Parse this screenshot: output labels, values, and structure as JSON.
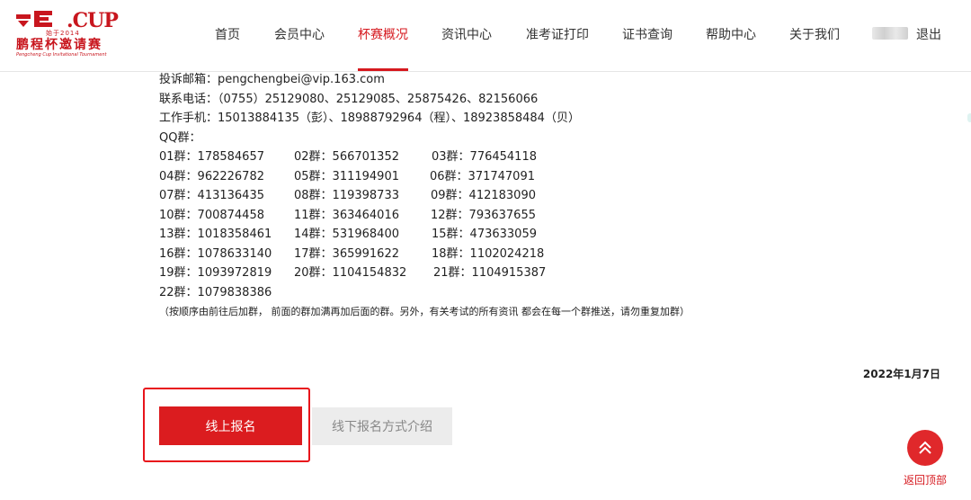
{
  "logo": {
    "cup_text": ".CUP",
    "year_text": "始于2014",
    "cn_text": "鹏程杯邀请赛",
    "en_text": "Pengcheng Cup Invitational Tournament"
  },
  "nav": {
    "items": [
      {
        "label": "首页"
      },
      {
        "label": "会员中心"
      },
      {
        "label": "杯赛概况"
      },
      {
        "label": "资讯中心"
      },
      {
        "label": "准考证打印"
      },
      {
        "label": "证书查询"
      },
      {
        "label": "帮助中心"
      },
      {
        "label": "关于我们"
      }
    ],
    "active_index": 2,
    "logout": "退出"
  },
  "contact": {
    "email_line": "投诉邮箱：pengchengbei@vip.163.com",
    "phone_line": "联系电话：（0755）25129080、25129085、25875426、82156066",
    "mobile_line": "工作手机：15013884135（彭）、18988792964（程）、18923858484（贝）",
    "qq_title": "QQ群："
  },
  "qq_groups": [
    [
      "01群：178584657",
      "02群：566701352",
      "03群：776454118"
    ],
    [
      "04群：962226782",
      "05群：311194901",
      "06群：371747091"
    ],
    [
      "07群：413136435",
      "08群：119398733",
      "09群：412183090"
    ],
    [
      "10群：700874458",
      "11群：363464016",
      "12群：793637655"
    ],
    [
      "13群：1018358461",
      "14群：531968400",
      "15群：473633059"
    ],
    [
      "16群：1078633140",
      "17群：365991622",
      "18群：1102024218"
    ],
    [
      "19群：1093972819",
      "20群：1104154832",
      "21群：1104915387"
    ],
    [
      "22群：1079838386"
    ]
  ],
  "note": "（按顺序由前往后加群，  前面的群加满再加后面的群。另外，有关考试的所有资讯   都会在每一个群推送，请勿重复加群）",
  "date": "2022年1月7日",
  "buttons": {
    "online": "线上报名",
    "offline": "线下报名方式介绍"
  },
  "back_top": "返回顶部",
  "colors": {
    "brand_red": "#d6191f",
    "button_red": "#db1c1f",
    "highlight_border": "#e8141b"
  }
}
